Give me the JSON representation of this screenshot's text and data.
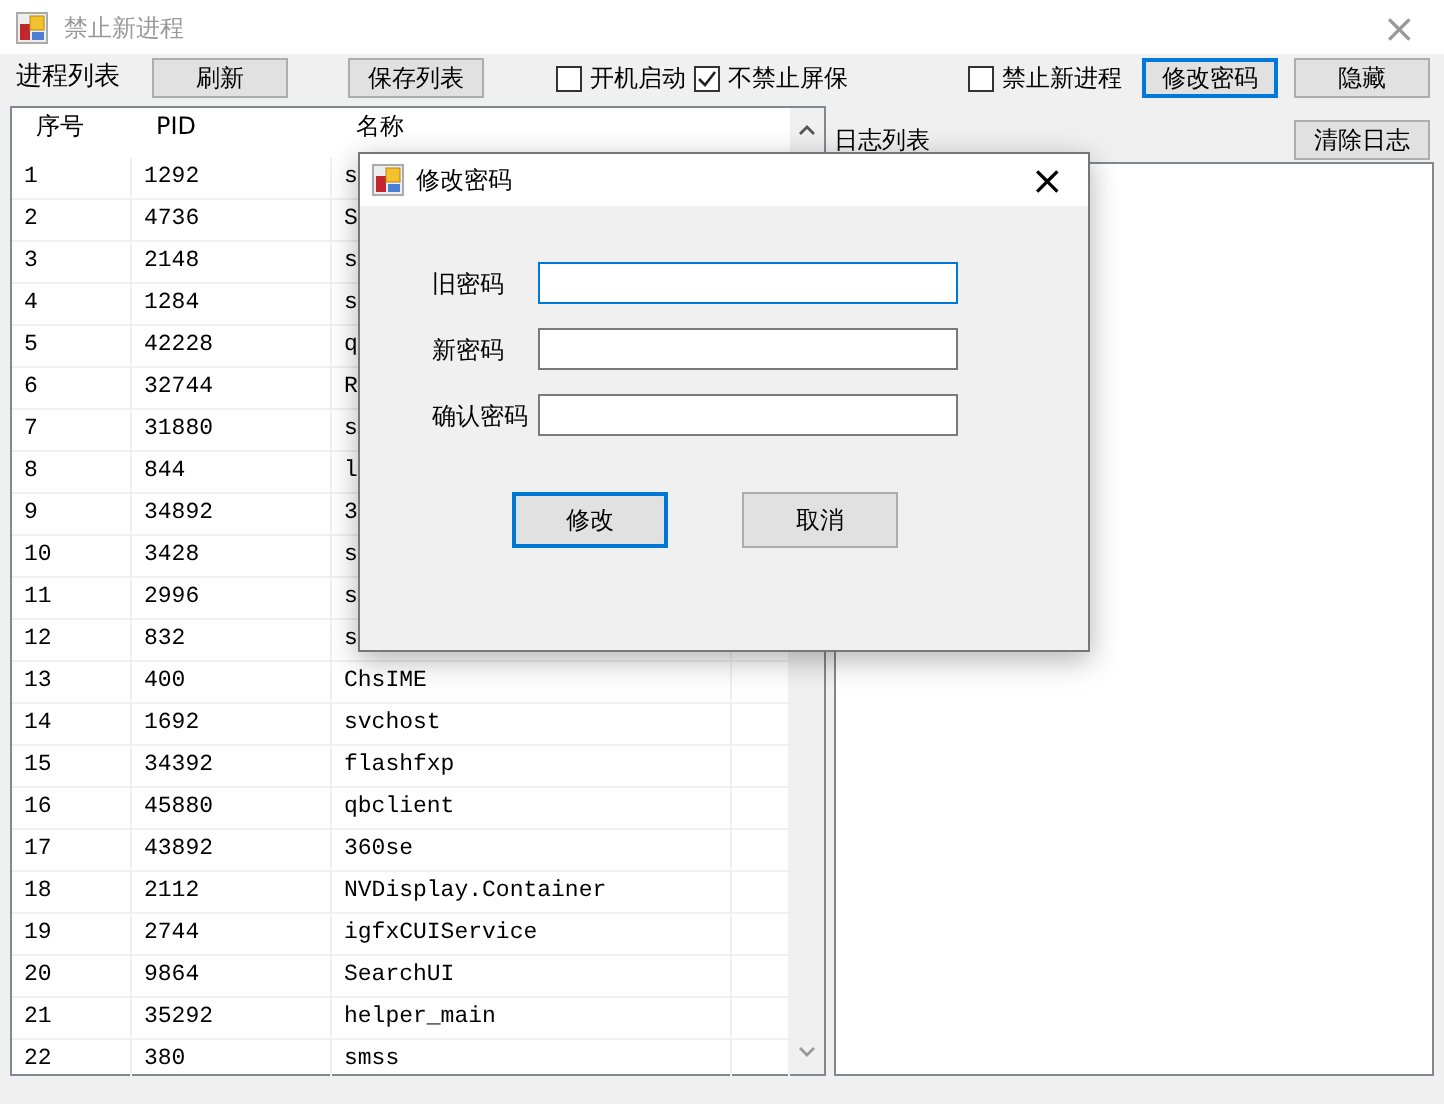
{
  "window": {
    "title": "禁止新进程",
    "close": "×"
  },
  "toolbar": [
    {
      "kind": "label",
      "label": "进程列表"
    },
    {
      "kind": "button",
      "label": "刷新",
      "focused": false
    },
    {
      "kind": "button",
      "label": "保存列表",
      "focused": false
    },
    {
      "kind": "checkbox",
      "label": "开机启动",
      "checked": false
    },
    {
      "kind": "checkbox",
      "label": "不禁止屏保",
      "checked": true
    },
    {
      "kind": "checkbox",
      "label": "禁止新进程",
      "checked": false
    },
    {
      "kind": "button",
      "label": "修改密码",
      "focused": true
    },
    {
      "kind": "button",
      "label": "隐藏",
      "focused": false
    }
  ],
  "process_table": {
    "columns": [
      "序号",
      "PID",
      "名称"
    ],
    "rows": [
      [
        "1",
        "1292",
        "s"
      ],
      [
        "2",
        "4736",
        "S"
      ],
      [
        "3",
        "2148",
        "s"
      ],
      [
        "4",
        "1284",
        "s"
      ],
      [
        "5",
        "42228",
        "q"
      ],
      [
        "6",
        "32744",
        "R"
      ],
      [
        "7",
        "31880",
        "s"
      ],
      [
        "8",
        "844",
        "l"
      ],
      [
        "9",
        "34892",
        "3"
      ],
      [
        "10",
        "3428",
        "s"
      ],
      [
        "11",
        "2996",
        "s"
      ],
      [
        "12",
        "832",
        "s"
      ],
      [
        "13",
        "400",
        "ChsIME"
      ],
      [
        "14",
        "1692",
        "svchost"
      ],
      [
        "15",
        "34392",
        "flashfxp"
      ],
      [
        "16",
        "45880",
        "qbclient"
      ],
      [
        "17",
        "43892",
        "360se"
      ],
      [
        "18",
        "2112",
        "NVDisplay.Container"
      ],
      [
        "19",
        "2744",
        "igfxCUIService"
      ],
      [
        "20",
        "9864",
        "SearchUI"
      ],
      [
        "21",
        "35292",
        "helper_main"
      ],
      [
        "22",
        "380",
        "smss"
      ]
    ]
  },
  "log_panel": {
    "label": "日志列表",
    "clear_button": "清除日志"
  },
  "dialog": {
    "title": "修改密码",
    "close": "×",
    "fields": [
      {
        "label": "旧密码",
        "focused": true
      },
      {
        "label": "新密码",
        "focused": false
      },
      {
        "label": "确认密码",
        "focused": false
      }
    ],
    "buttons": [
      {
        "label": "修改",
        "focused": true
      },
      {
        "label": "取消",
        "focused": false
      }
    ]
  }
}
